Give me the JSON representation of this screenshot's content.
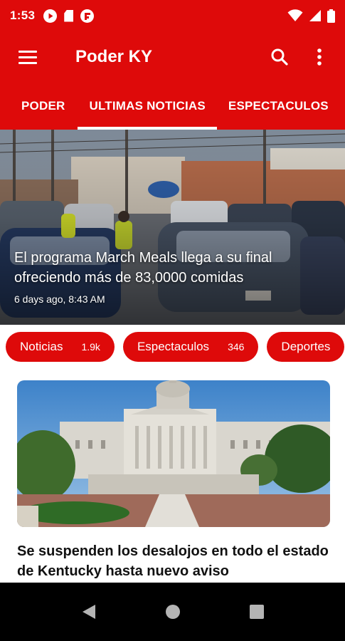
{
  "status_bar": {
    "time": "1:53",
    "icons": [
      "play-circle-icon",
      "sd-card-icon",
      "flipboard-icon",
      "wifi-icon",
      "signal-icon",
      "battery-icon"
    ]
  },
  "app_bar": {
    "title": "Poder KY",
    "color": "#de0a0a",
    "icons": [
      "menu-icon",
      "search-icon",
      "more-vert-icon"
    ]
  },
  "tabs": [
    {
      "label": "PODER"
    },
    {
      "label": "ULTIMAS NOTICIAS",
      "selected": true
    },
    {
      "label": "ESPECTACULOS"
    }
  ],
  "hero": {
    "title": "El programa March Meals llega a su final ofreciendo más de 83,0000 comidas",
    "meta": "6 days ago, 8:43 AM"
  },
  "categories": [
    {
      "label": "Noticias",
      "count": "1.9k"
    },
    {
      "label": "Espectaculos",
      "count": "346"
    },
    {
      "label": "Deportes",
      "count": ""
    }
  ],
  "article": {
    "title": "Se suspenden los desalojos en todo el estado de Kentucky hasta nuevo aviso"
  },
  "nav_bar": {
    "icons": [
      "back-icon",
      "home-icon",
      "recents-icon"
    ]
  }
}
